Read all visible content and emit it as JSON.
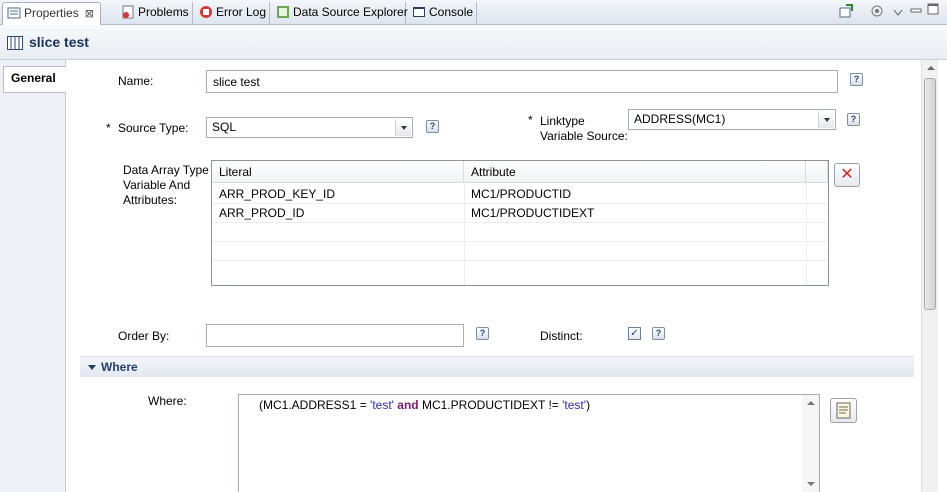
{
  "tabs": [
    {
      "label": "Properties",
      "icon": "properties-icon",
      "active": true
    },
    {
      "label": "Problems",
      "icon": "problems-icon"
    },
    {
      "label": "Error Log",
      "icon": "error-log-icon"
    },
    {
      "label": "Data Source Explorer",
      "icon": "data-source-icon"
    },
    {
      "label": "Console",
      "icon": "console-icon"
    }
  ],
  "header": {
    "title": "slice test"
  },
  "side_tabs": [
    "General"
  ],
  "form": {
    "name_label": "Name:",
    "name_value": "slice test",
    "required_mark": "*",
    "source_type_label": "Source Type:",
    "source_type_value": "SQL",
    "linktype_label_1": "Linktype",
    "linktype_label_2": "Variable Source:",
    "linktype_value": "ADDRESS(MC1)",
    "data_array_label_1": "Data Array Type",
    "data_array_label_2": "Variable And",
    "data_array_label_3": "Attributes:",
    "order_by_label": "Order By:",
    "order_by_value": "",
    "distinct_label": "Distinct:",
    "distinct_checked": true,
    "help_glyph": "?",
    "delete_glyph": "✕",
    "check_glyph": "✓"
  },
  "table": {
    "columns": [
      "Literal",
      "Attribute"
    ],
    "rows": [
      [
        "ARR_PROD_KEY_ID",
        "MC1/PRODUCTID"
      ],
      [
        "ARR_PROD_ID",
        "MC1/PRODUCTIDEXT"
      ]
    ]
  },
  "where_section": {
    "title": "Where",
    "where_label": "Where:",
    "clause": {
      "p1": "(MC1.ADDRESS1 = ",
      "s1": "'test'",
      "kw": " and ",
      "p2": "MC1.PRODUCTIDEXT != ",
      "s2": "'test'",
      "p3": ")"
    }
  }
}
